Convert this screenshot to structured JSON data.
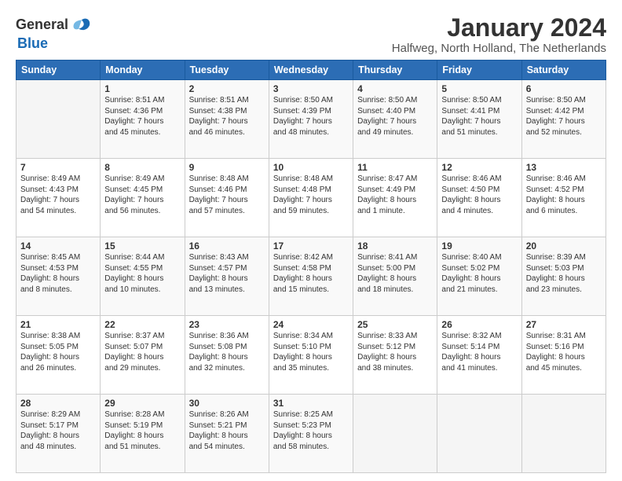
{
  "header": {
    "logo_general": "General",
    "logo_blue": "Blue",
    "month_title": "January 2024",
    "location": "Halfweg, North Holland, The Netherlands"
  },
  "days_of_week": [
    "Sunday",
    "Monday",
    "Tuesday",
    "Wednesday",
    "Thursday",
    "Friday",
    "Saturday"
  ],
  "weeks": [
    [
      {
        "day": "",
        "info": ""
      },
      {
        "day": "1",
        "info": "Sunrise: 8:51 AM\nSunset: 4:36 PM\nDaylight: 7 hours\nand 45 minutes."
      },
      {
        "day": "2",
        "info": "Sunrise: 8:51 AM\nSunset: 4:38 PM\nDaylight: 7 hours\nand 46 minutes."
      },
      {
        "day": "3",
        "info": "Sunrise: 8:50 AM\nSunset: 4:39 PM\nDaylight: 7 hours\nand 48 minutes."
      },
      {
        "day": "4",
        "info": "Sunrise: 8:50 AM\nSunset: 4:40 PM\nDaylight: 7 hours\nand 49 minutes."
      },
      {
        "day": "5",
        "info": "Sunrise: 8:50 AM\nSunset: 4:41 PM\nDaylight: 7 hours\nand 51 minutes."
      },
      {
        "day": "6",
        "info": "Sunrise: 8:50 AM\nSunset: 4:42 PM\nDaylight: 7 hours\nand 52 minutes."
      }
    ],
    [
      {
        "day": "7",
        "info": "Sunrise: 8:49 AM\nSunset: 4:43 PM\nDaylight: 7 hours\nand 54 minutes."
      },
      {
        "day": "8",
        "info": "Sunrise: 8:49 AM\nSunset: 4:45 PM\nDaylight: 7 hours\nand 56 minutes."
      },
      {
        "day": "9",
        "info": "Sunrise: 8:48 AM\nSunset: 4:46 PM\nDaylight: 7 hours\nand 57 minutes."
      },
      {
        "day": "10",
        "info": "Sunrise: 8:48 AM\nSunset: 4:48 PM\nDaylight: 7 hours\nand 59 minutes."
      },
      {
        "day": "11",
        "info": "Sunrise: 8:47 AM\nSunset: 4:49 PM\nDaylight: 8 hours\nand 1 minute."
      },
      {
        "day": "12",
        "info": "Sunrise: 8:46 AM\nSunset: 4:50 PM\nDaylight: 8 hours\nand 4 minutes."
      },
      {
        "day": "13",
        "info": "Sunrise: 8:46 AM\nSunset: 4:52 PM\nDaylight: 8 hours\nand 6 minutes."
      }
    ],
    [
      {
        "day": "14",
        "info": "Sunrise: 8:45 AM\nSunset: 4:53 PM\nDaylight: 8 hours\nand 8 minutes."
      },
      {
        "day": "15",
        "info": "Sunrise: 8:44 AM\nSunset: 4:55 PM\nDaylight: 8 hours\nand 10 minutes."
      },
      {
        "day": "16",
        "info": "Sunrise: 8:43 AM\nSunset: 4:57 PM\nDaylight: 8 hours\nand 13 minutes."
      },
      {
        "day": "17",
        "info": "Sunrise: 8:42 AM\nSunset: 4:58 PM\nDaylight: 8 hours\nand 15 minutes."
      },
      {
        "day": "18",
        "info": "Sunrise: 8:41 AM\nSunset: 5:00 PM\nDaylight: 8 hours\nand 18 minutes."
      },
      {
        "day": "19",
        "info": "Sunrise: 8:40 AM\nSunset: 5:02 PM\nDaylight: 8 hours\nand 21 minutes."
      },
      {
        "day": "20",
        "info": "Sunrise: 8:39 AM\nSunset: 5:03 PM\nDaylight: 8 hours\nand 23 minutes."
      }
    ],
    [
      {
        "day": "21",
        "info": "Sunrise: 8:38 AM\nSunset: 5:05 PM\nDaylight: 8 hours\nand 26 minutes."
      },
      {
        "day": "22",
        "info": "Sunrise: 8:37 AM\nSunset: 5:07 PM\nDaylight: 8 hours\nand 29 minutes."
      },
      {
        "day": "23",
        "info": "Sunrise: 8:36 AM\nSunset: 5:08 PM\nDaylight: 8 hours\nand 32 minutes."
      },
      {
        "day": "24",
        "info": "Sunrise: 8:34 AM\nSunset: 5:10 PM\nDaylight: 8 hours\nand 35 minutes."
      },
      {
        "day": "25",
        "info": "Sunrise: 8:33 AM\nSunset: 5:12 PM\nDaylight: 8 hours\nand 38 minutes."
      },
      {
        "day": "26",
        "info": "Sunrise: 8:32 AM\nSunset: 5:14 PM\nDaylight: 8 hours\nand 41 minutes."
      },
      {
        "day": "27",
        "info": "Sunrise: 8:31 AM\nSunset: 5:16 PM\nDaylight: 8 hours\nand 45 minutes."
      }
    ],
    [
      {
        "day": "28",
        "info": "Sunrise: 8:29 AM\nSunset: 5:17 PM\nDaylight: 8 hours\nand 48 minutes."
      },
      {
        "day": "29",
        "info": "Sunrise: 8:28 AM\nSunset: 5:19 PM\nDaylight: 8 hours\nand 51 minutes."
      },
      {
        "day": "30",
        "info": "Sunrise: 8:26 AM\nSunset: 5:21 PM\nDaylight: 8 hours\nand 54 minutes."
      },
      {
        "day": "31",
        "info": "Sunrise: 8:25 AM\nSunset: 5:23 PM\nDaylight: 8 hours\nand 58 minutes."
      },
      {
        "day": "",
        "info": ""
      },
      {
        "day": "",
        "info": ""
      },
      {
        "day": "",
        "info": ""
      }
    ]
  ]
}
